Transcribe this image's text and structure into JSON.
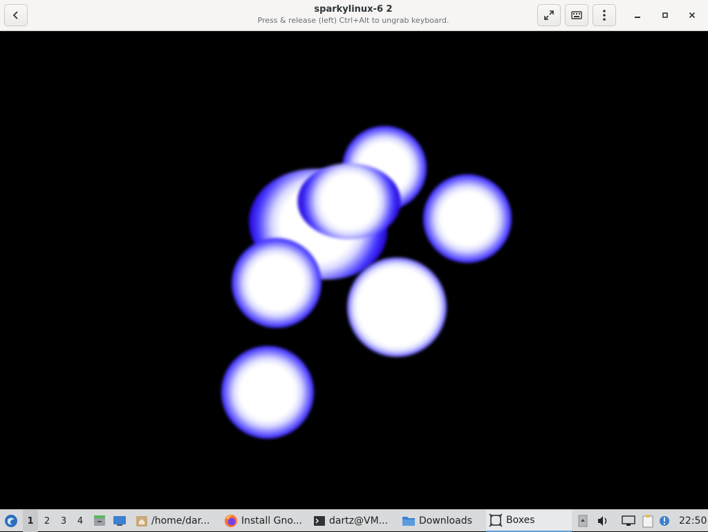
{
  "window": {
    "title": "sparkylinux-6 2",
    "subtitle": "Press & release (left) Ctrl+Alt to ungrab keyboard."
  },
  "header_icons": [
    "back-arrow-icon",
    "fullscreen-icon",
    "keyboard-icon",
    "kebab-menu-icon",
    "minimize-icon",
    "maximize-icon",
    "close-icon"
  ],
  "taskbar": {
    "workspaces": [
      "1",
      "2",
      "3",
      "4"
    ],
    "active_workspace": "1",
    "tasks": [
      {
        "label": "/home/dar...",
        "icon": "folder-home-icon"
      },
      {
        "label": "Install Gno...",
        "icon": "firefox-icon"
      },
      {
        "label": "dartz@VM...",
        "icon": "terminal-icon"
      },
      {
        "label": "Downloads",
        "icon": "folder-icon"
      },
      {
        "label": "Boxes",
        "icon": "boxes-icon"
      }
    ],
    "active_task": "Boxes",
    "clock": "22:50"
  },
  "colors": {
    "header_bg": "#f6f5f4",
    "display_bg": "#000000",
    "blob_glow": "#2a10e0",
    "taskbar_bg": "#d9dadb",
    "active_task_underline": "#5d9fd8"
  }
}
